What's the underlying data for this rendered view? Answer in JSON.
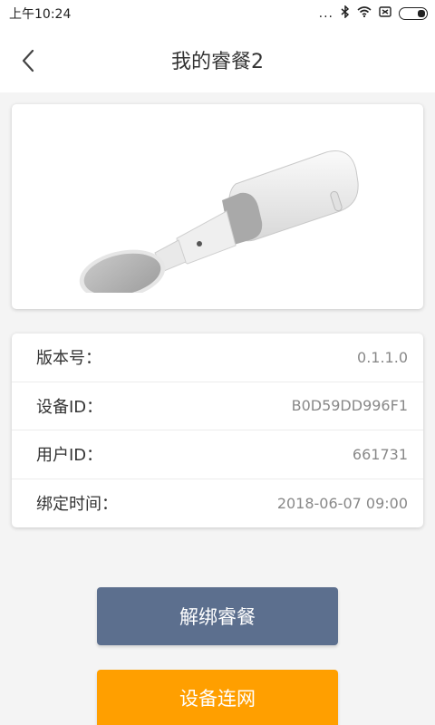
{
  "status_bar": {
    "time": "上午10:24",
    "dots": "...",
    "icons": [
      "bluetooth-icon",
      "wifi-icon",
      "sim-icon",
      "battery-icon"
    ]
  },
  "header": {
    "back_icon": "chevron-left-icon",
    "title": "我的睿餐2"
  },
  "product": {
    "image": "smart-spoon-device"
  },
  "info": {
    "rows": [
      {
        "label": "版本号：",
        "value": "0.1.1.0"
      },
      {
        "label": "设备ID：",
        "value": "B0D59DD996F1"
      },
      {
        "label": "用户ID：",
        "value": "661731"
      },
      {
        "label": "绑定时间：",
        "value": "2018-06-07 09:00"
      }
    ]
  },
  "actions": {
    "unbind_label": "解绑睿餐",
    "network_label": "设备连网"
  },
  "colors": {
    "unbind_button": "#5c6f8e",
    "network_button": "#ff9f00",
    "background": "#f4f4f4"
  }
}
